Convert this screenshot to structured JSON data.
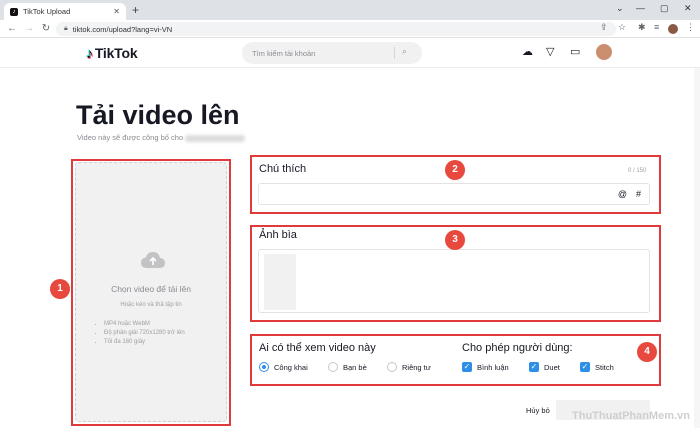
{
  "browser": {
    "tab_title": "TikTok Upload",
    "tab_icon": "tiktok-favicon",
    "url": "tiktok.com/upload?lang=vi-VN"
  },
  "header": {
    "logo_text": "TikTok",
    "search_placeholder": "Tìm kiếm tài khoản",
    "icons": [
      "upload-cloud-icon",
      "send-icon",
      "inbox-icon",
      "avatar"
    ]
  },
  "page": {
    "title": "Tải video lên",
    "subtitle": "Video này sẽ được công bố cho"
  },
  "uploader": {
    "title": "Chọn video để tải lên",
    "subtitle": "Hoặc kéo và thả tập tin",
    "requirements": [
      "MP4 hoặc WebM",
      "Độ phân giải 720x1280 trở lên",
      "Tối đa 180 giây"
    ]
  },
  "caption": {
    "label": "Chú thích",
    "counter": "0 / 150",
    "at_symbol": "@",
    "hash_symbol": "#"
  },
  "cover": {
    "label": "Ảnh bìa"
  },
  "privacy": {
    "label": "Ai có thể xem video này",
    "options": [
      "Công khai",
      "Bạn bè",
      "Riêng tư"
    ],
    "selected": "Công khai"
  },
  "permissions": {
    "label": "Cho phép người dùng:",
    "options": [
      "Bình luận",
      "Duet",
      "Stitch"
    ]
  },
  "actions": {
    "cancel_label": "Hủy bỏ"
  },
  "annotations": [
    "1",
    "2",
    "3",
    "4"
  ],
  "watermark": "ThuThuatPhanMem.vn",
  "colors": {
    "annotation_red": "#e03a3a",
    "checkbox_blue": "#2f8fe6",
    "upload_bg": "#f1f1f2"
  }
}
